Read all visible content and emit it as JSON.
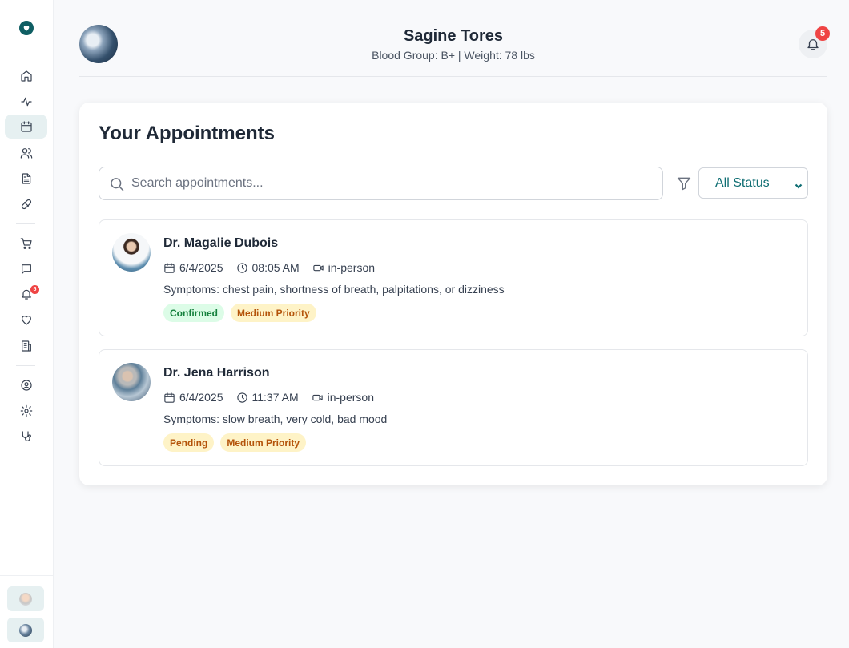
{
  "sidebar": {
    "logo_icon": "heart-logo-icon",
    "nav": [
      {
        "icon": "home-icon",
        "name": "sidebar-item-home"
      },
      {
        "icon": "activity-icon",
        "name": "sidebar-item-activity"
      },
      {
        "icon": "calendar-icon",
        "name": "sidebar-item-appointments",
        "active": true
      },
      {
        "icon": "users-icon",
        "name": "sidebar-item-doctors"
      },
      {
        "icon": "file-icon",
        "name": "sidebar-item-records"
      },
      {
        "icon": "pill-icon",
        "name": "sidebar-item-medications"
      },
      {
        "icon": "cart-icon",
        "name": "sidebar-item-pharmacy"
      },
      {
        "icon": "message-icon",
        "name": "sidebar-item-messages"
      },
      {
        "icon": "bell-icon",
        "name": "sidebar-item-notifications"
      },
      {
        "icon": "heart-icon",
        "name": "sidebar-item-favorites"
      },
      {
        "icon": "building-icon",
        "name": "sidebar-item-hospitals"
      },
      {
        "icon": "user-circle-icon",
        "name": "sidebar-item-profile"
      },
      {
        "icon": "gear-icon",
        "name": "sidebar-item-settings"
      },
      {
        "icon": "stethoscope-icon",
        "name": "sidebar-item-consult"
      }
    ],
    "notification_count": "5"
  },
  "header": {
    "patient_name": "Sagine Tores",
    "patient_meta": "Blood Group: B+ | Weight: 78 lbs",
    "notification_count": "5"
  },
  "appointments_card": {
    "title": "Your Appointments",
    "search_placeholder": "Search appointments...",
    "status_filter": "All Status",
    "items": [
      {
        "doctor": "Dr. Magalie Dubois",
        "date": "6/4/2025",
        "time": "08:05 AM",
        "mode": "in-person",
        "symptoms": "Symptoms: chest pain, shortness of breath, palpitations, or dizziness",
        "status": "Confirmed",
        "priority": "Medium Priority"
      },
      {
        "doctor": "Dr. Jena Harrison",
        "date": "6/4/2025",
        "time": "11:37 AM",
        "mode": "in-person",
        "symptoms": "Symptoms: slow breath, very cold, bad mood",
        "status": "Pending",
        "priority": "Medium Priority"
      }
    ]
  },
  "colors": {
    "accent": "#0f6e73",
    "active_nav_bg": "#e6f0f1",
    "badge_red": "#ef4444",
    "confirmed_bg": "#dcfce7",
    "pending_bg": "#fef3c7"
  }
}
